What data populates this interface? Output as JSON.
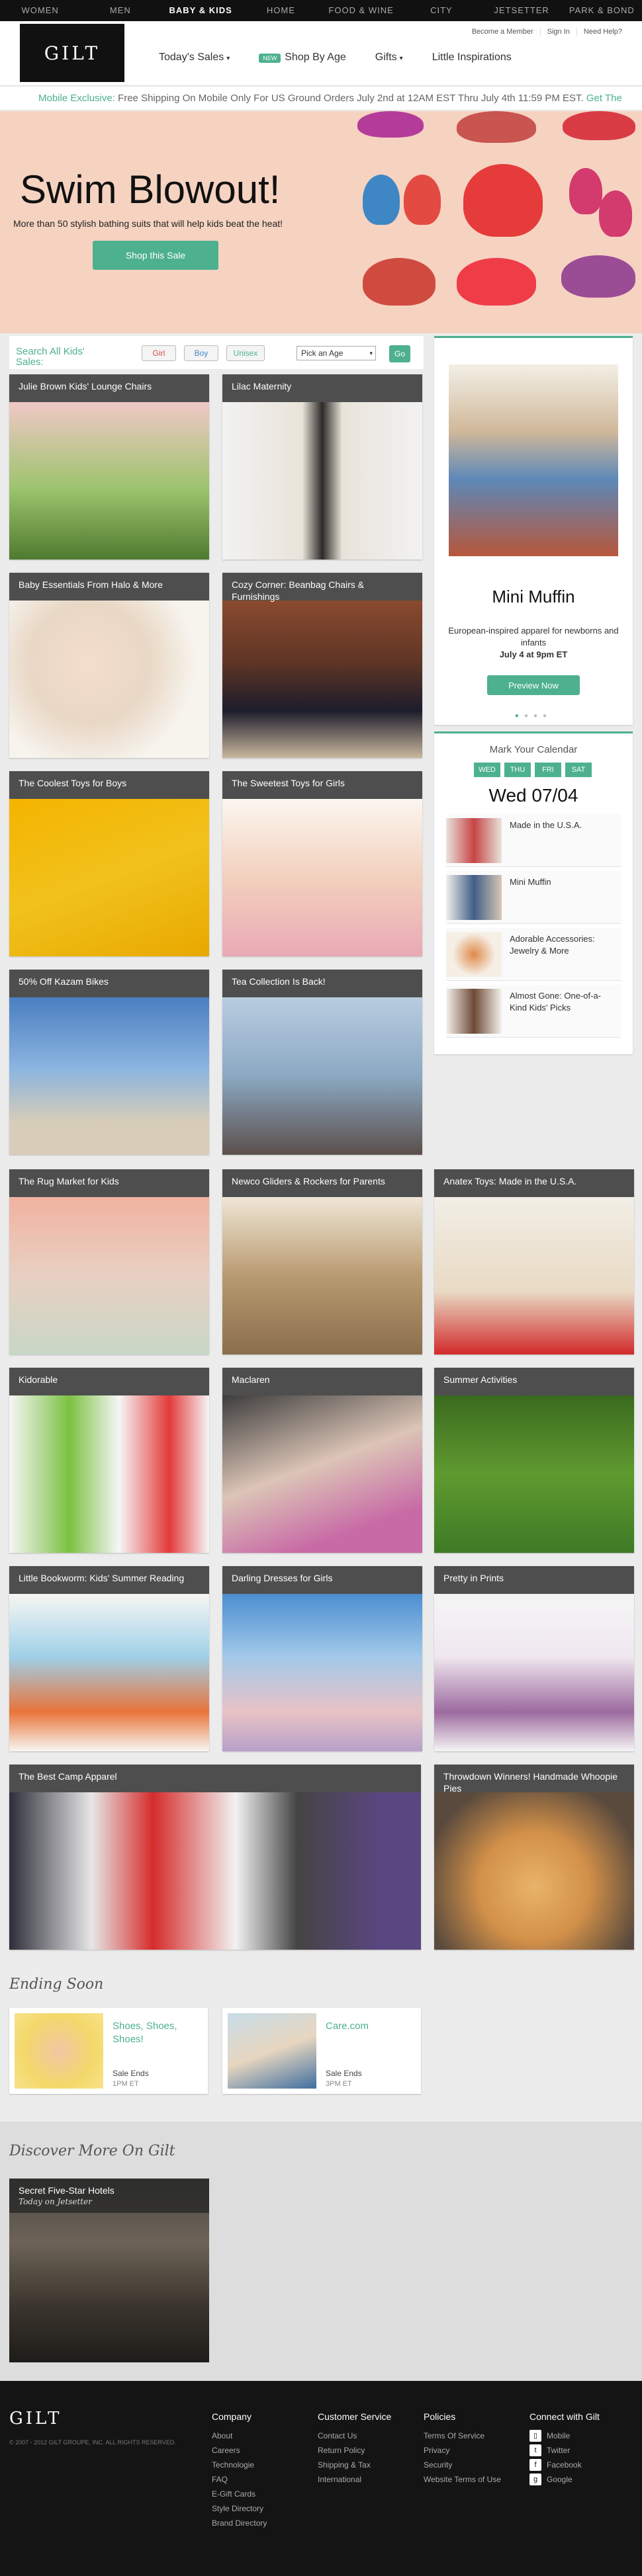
{
  "topnav": [
    "WOMEN",
    "MEN",
    "BABY & KIDS",
    "HOME",
    "FOOD & WINE",
    "CITY",
    "JETSETTER",
    "PARK & BOND"
  ],
  "header": {
    "logo": "GILT",
    "util": [
      "Become a Member",
      "Sign In",
      "Need Help?"
    ],
    "nav": {
      "todays_sales": "Today's Sales",
      "new_badge": "NEW",
      "shop_by_age": "Shop By Age",
      "gifts": "Gifts",
      "inspirations": "Little Inspirations"
    }
  },
  "promo": {
    "accent": "Mobile Exclusive:",
    "text": " Free Shipping On Mobile Only For US Ground Orders July 2nd at 12AM EST Thru July 4th 11:59 PM EST.",
    "link": "Get The"
  },
  "hero": {
    "title": "Swim Blowout!",
    "subtitle": "More than 50 stylish bathing suits that will help kids beat the heat!",
    "button": "Shop this Sale"
  },
  "search": {
    "label": "Search All Kids' Sales:",
    "girl": "Girl",
    "boy": "Boy",
    "unisex": "Unisex",
    "age": "Pick an Age",
    "go": "Go"
  },
  "tiles": [
    "Julie Brown Kids' Lounge Chairs",
    "Lilac Maternity",
    "Baby Essentials From Halo & More",
    "Cozy Corner: Beanbag Chairs & Furnishings",
    "The Coolest Toys for Boys",
    "The Sweetest Toys for Girls",
    "50% Off Kazam Bikes",
    "Tea Collection Is Back!",
    "The Rug Market for Kids",
    "Newco Gliders & Rockers for Parents",
    "Anatex Toys: Made in the U.S.A.",
    "Kidorable",
    "Maclaren",
    "Summer Activities",
    "Little Bookworm: Kids' Summer Reading",
    "Darling Dresses for Girls",
    "Pretty in Prints",
    "The Best Camp Apparel",
    "Throwdown Winners! Handmade Whoopie Pies"
  ],
  "muffin": {
    "title": "Mini Muffin",
    "desc": "European-inspired apparel for newborns and infants",
    "date": "July 4 at 9pm ET",
    "button": "Preview Now"
  },
  "calendar": {
    "head": "Mark Your Calendar",
    "days": [
      "WED",
      "THU",
      "FRI",
      "SAT"
    ],
    "date": "Wed 07/04",
    "items": [
      "Made in the U.S.A.",
      "Mini Muffin",
      "Adorable Accessories: Jewelry & More",
      "Almost Gone: One-of-a-Kind Kids' Picks"
    ]
  },
  "ending_soon": {
    "title": "Ending Soon",
    "cards": [
      {
        "name": "Shoes, Shoes, Shoes!",
        "label": "Sale Ends",
        "time": "1PM ET"
      },
      {
        "name": "Care.com",
        "label": "Sale Ends",
        "time": "3PM ET"
      }
    ]
  },
  "discover": {
    "title": "Discover More On Gilt",
    "card_title": "Secret Five-Star Hotels",
    "card_sub": "Today on Jetsetter"
  },
  "footer": {
    "logo": "GILT",
    "copyright": "© 2007 - 2012 GILT GROUPE, INC. ALL RIGHTS RESERVED.",
    "company": {
      "head": "Company",
      "links": [
        "About",
        "Careers",
        "Technologie",
        "FAQ",
        "E-Gift Cards",
        "Style Directory",
        "Brand Directory"
      ]
    },
    "service": {
      "head": "Customer Service",
      "links": [
        "Contact Us",
        "Return Policy",
        "Shipping & Tax",
        "International"
      ]
    },
    "policies": {
      "head": "Policies",
      "links": [
        "Terms Of Service",
        "Privacy",
        "Security",
        "Website Terms of Use"
      ]
    },
    "connect": {
      "head": "Connect with Gilt",
      "links": [
        "Mobile",
        "Twitter",
        "Facebook",
        "Google"
      ]
    }
  },
  "colors": {
    "accent": "#4db08f",
    "dark": "#111111"
  }
}
